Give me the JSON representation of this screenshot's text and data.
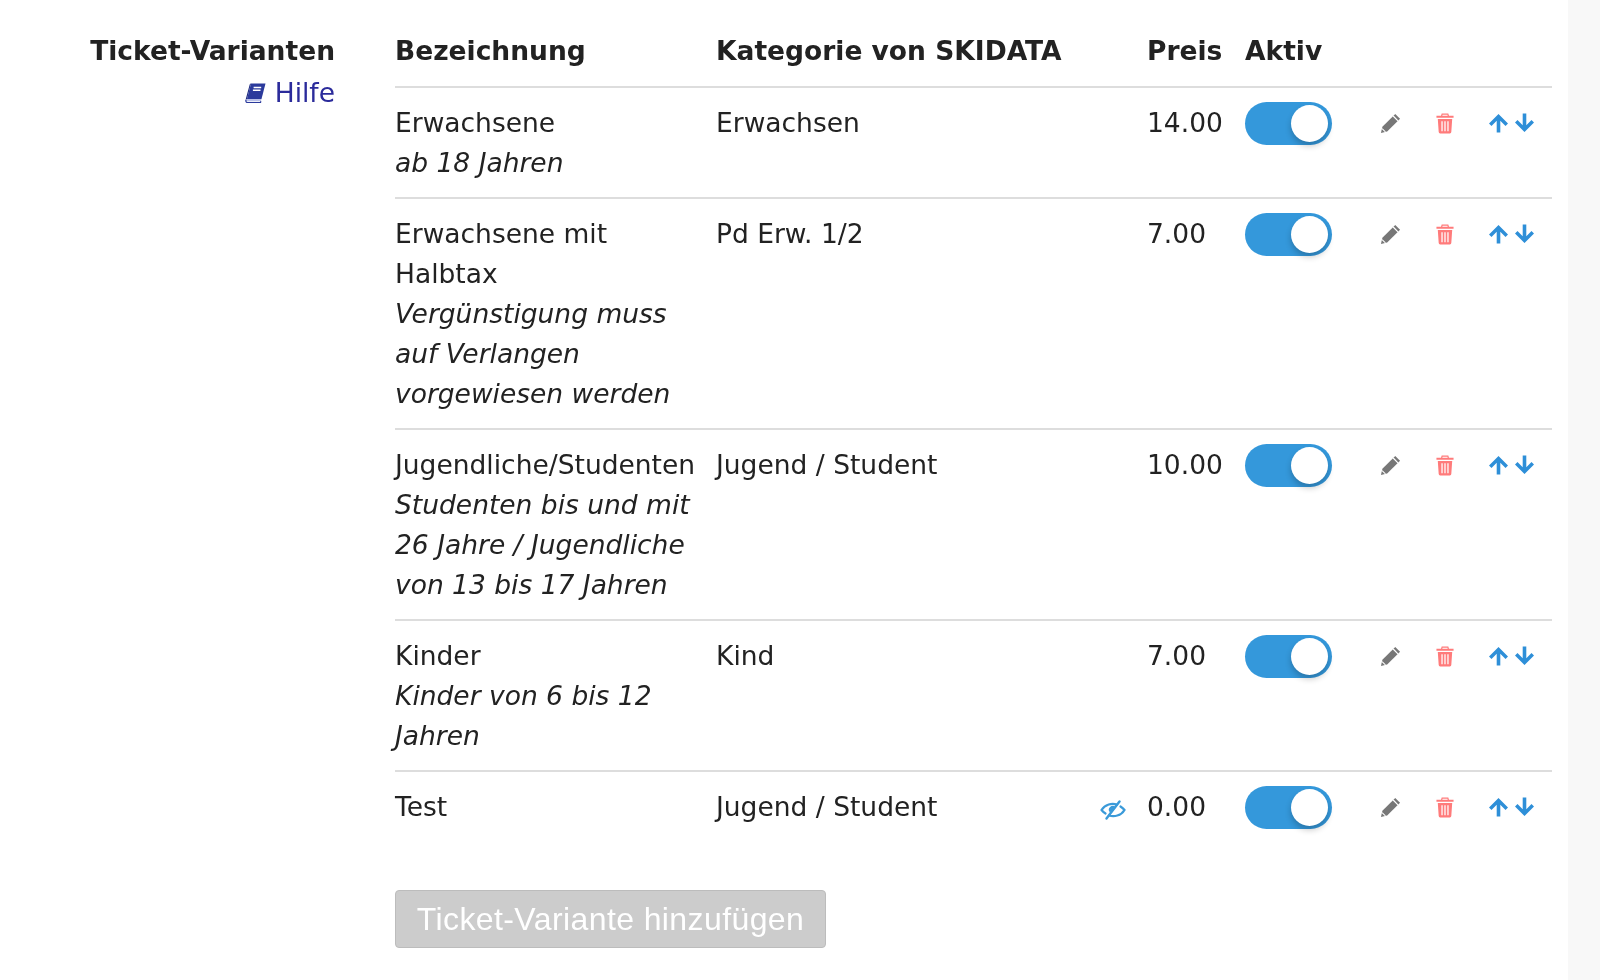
{
  "section": {
    "title": "Ticket-Varianten",
    "help_link": "Hilfe"
  },
  "table": {
    "columns": [
      "Bezeichnung",
      "Kategorie von SKIDATA",
      "Preis",
      "Aktiv"
    ],
    "rows": [
      {
        "name": "Erwachsene",
        "description": "ab 18 Jahren",
        "category": "Erwachsen",
        "hidden": false,
        "price": "14.00",
        "active": true
      },
      {
        "name": "Erwachsene mit Halbtax",
        "description": "Vergünstigung muss auf Verlangen vorgewiesen werden",
        "category": "Pd Erw. 1/2",
        "hidden": false,
        "price": "7.00",
        "active": true
      },
      {
        "name": "Jugendliche/Studenten",
        "description": "Studenten bis und mit 26 Jahre / Jugendliche von 13 bis 17 Jahren",
        "category": "Jugend / Student",
        "hidden": false,
        "price": "10.00",
        "active": true
      },
      {
        "name": "Kinder",
        "description": "Kinder von 6 bis 12 Jahren",
        "category": "Kind",
        "hidden": false,
        "price": "7.00",
        "active": true
      },
      {
        "name": "Test",
        "category": "Jugend / Student",
        "hidden": true,
        "price": "0.00",
        "active": true
      }
    ]
  },
  "add_button": {
    "label": "Ticket-Variante hinzufügen",
    "disabled": true
  }
}
